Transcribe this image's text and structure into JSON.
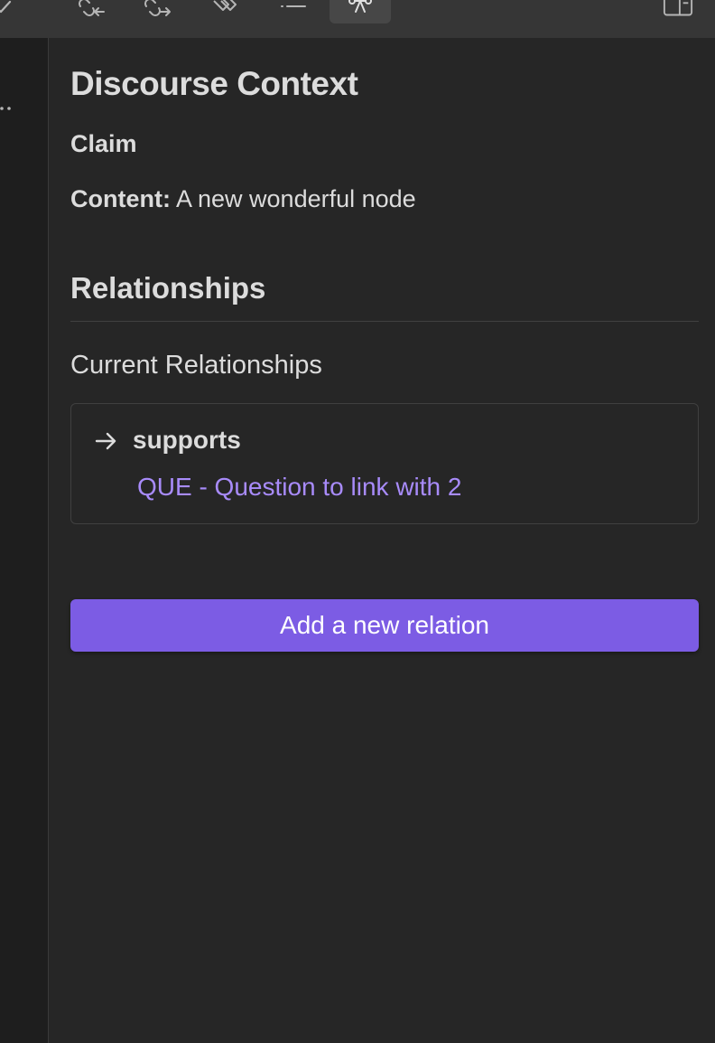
{
  "toolbar": {
    "icons": [
      "check-icon",
      "incoming-links-icon",
      "outgoing-links-icon",
      "tags-icon",
      "outline-icon",
      "discourse-graph-icon",
      "layout-sidebar-icon"
    ],
    "active": "discourse-graph-icon"
  },
  "left_pane": {
    "icon": "more-options-icon"
  },
  "panel": {
    "title": "Discourse Context",
    "node_type": "Claim",
    "content_label": "Content:",
    "content_value": " A new wonderful node",
    "relationships_heading": "Relationships",
    "current_heading": "Current Relationships",
    "relations": [
      {
        "label": "supports",
        "target": "QUE - Question to link with 2"
      }
    ],
    "add_button_label": "Add a new relation"
  },
  "colors": {
    "background": "#262626",
    "toolbar": "#363636",
    "accent": "#7c5ce4",
    "link": "#a88bfa",
    "text": "#dcdcdc"
  }
}
